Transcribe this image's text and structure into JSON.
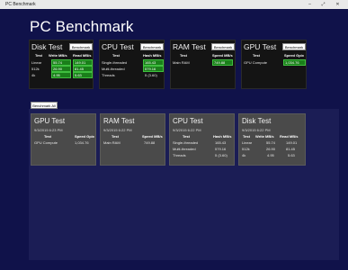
{
  "window": {
    "title": "PC Benchmark",
    "minimize": "–",
    "maximize": "⤢",
    "close": "✕"
  },
  "app_title": "PC Benchmark",
  "top_cards": {
    "disk": {
      "title": "Disk Test",
      "button": "Benchmark",
      "headers": [
        "Test",
        "Write MB/s",
        "Read MB/s"
      ],
      "rows": [
        [
          "Linear",
          "55.74",
          "149.01"
        ],
        [
          "512k",
          "26.90",
          "81.45"
        ],
        [
          "4k",
          "4.95",
          "5.63"
        ]
      ]
    },
    "cpu": {
      "title": "CPU Test",
      "button": "Benchmark",
      "headers": [
        "Test",
        "Hash MB/s"
      ],
      "rows": [
        [
          "Single-threaded",
          "165.43"
        ],
        [
          "Multi-threaded",
          "579.16"
        ],
        [
          "Threads",
          "5 (3.60)"
        ]
      ]
    },
    "ram": {
      "title": "RAM Test",
      "button": "Benchmark",
      "headers": [
        "Test",
        "Speed MB/s"
      ],
      "rows": [
        [
          "Main RAM",
          "749.88"
        ]
      ]
    },
    "gpu": {
      "title": "GPU Test",
      "button": "Benchmark",
      "headers": [
        "Test",
        "Speed Gpix"
      ],
      "rows": [
        [
          "GPU Compute",
          "1,034.76"
        ]
      ]
    }
  },
  "bench_all_button": "Benchmark All",
  "results": [
    {
      "title": "GPU Test",
      "timestamp": "9/3/2015 6:23 PM",
      "headers": [
        "Test",
        "Speed Gpix"
      ],
      "rows": [
        [
          "GPU Compute",
          "1,034.76"
        ]
      ]
    },
    {
      "title": "RAM Test",
      "timestamp": "9/3/2015 6:22 PM",
      "headers": [
        "Test",
        "Speed MB/s"
      ],
      "rows": [
        [
          "Main RAM",
          "749.88"
        ]
      ]
    },
    {
      "title": "CPU Test",
      "timestamp": "9/3/2015 6:22 PM",
      "headers": [
        "Test",
        "Hash MB/s"
      ],
      "rows": [
        [
          "Single-threaded",
          "165.43"
        ],
        [
          "Multi-threaded",
          "579.16"
        ],
        [
          "Threads",
          "5 (3.60)"
        ]
      ]
    },
    {
      "title": "Disk Test",
      "timestamp": "9/3/2015 6:22 PM",
      "headers": [
        "Test",
        "Write MB/s",
        "Read MB/s"
      ],
      "rows": [
        [
          "Linear",
          "55.74",
          "149.01"
        ],
        [
          "512k",
          "26.90",
          "81.45"
        ],
        [
          "4k",
          "4.95",
          "5.63"
        ]
      ]
    }
  ],
  "colors": {
    "background": "#10124a",
    "results_panel": "#1b1d55",
    "card": "#141414",
    "result_card": "#4a4a4a",
    "highlight": "#1a7f1a"
  }
}
